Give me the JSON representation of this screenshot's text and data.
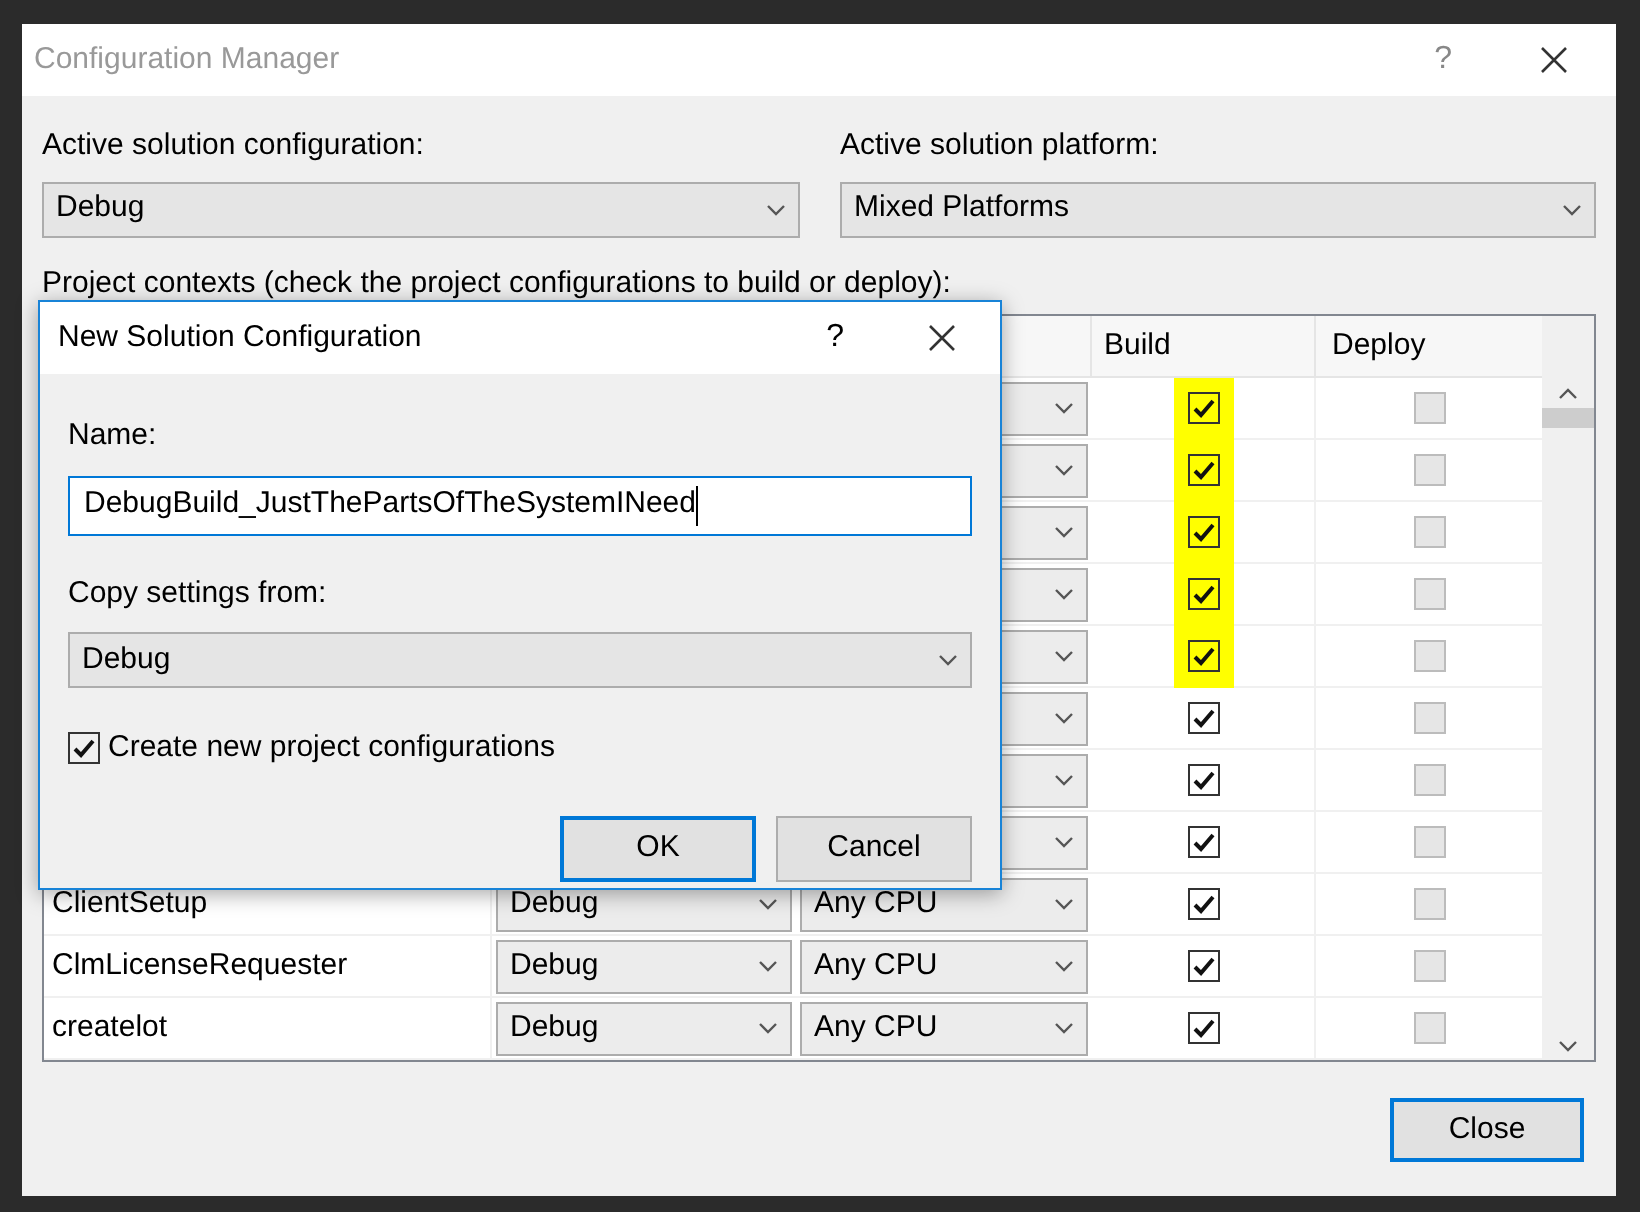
{
  "window": {
    "title": "Configuration Manager",
    "help": "?"
  },
  "active_configuration": {
    "label": "Active solution configuration:",
    "value": "Debug"
  },
  "active_platform": {
    "label": "Active solution platform:",
    "value": "Mixed Platforms"
  },
  "contexts_label": "Project contexts (check the project configurations to build or deploy):",
  "table": {
    "columns": [
      "Build",
      "Deploy"
    ],
    "rows": [
      {
        "build": true,
        "deploy": false,
        "highlighted": true
      },
      {
        "build": true,
        "deploy": false,
        "highlighted": true
      },
      {
        "build": true,
        "deploy": false,
        "highlighted": true
      },
      {
        "build": true,
        "deploy": false,
        "highlighted": true
      },
      {
        "build": true,
        "deploy": false,
        "highlighted": true
      },
      {
        "build": true,
        "deploy": false,
        "highlighted": false
      },
      {
        "build": true,
        "deploy": false,
        "highlighted": false
      },
      {
        "build": true,
        "deploy": false,
        "highlighted": false
      },
      {
        "project": "ClientSetup",
        "configuration": "Debug",
        "platform": "Any CPU",
        "build": true,
        "deploy": false,
        "highlighted": false
      },
      {
        "project": "ClmLicenseRequester",
        "configuration": "Debug",
        "platform": "Any CPU",
        "build": true,
        "deploy": false,
        "highlighted": false
      },
      {
        "project": "createlot",
        "configuration": "Debug",
        "platform": "Any CPU",
        "build": true,
        "deploy": false,
        "highlighted": false
      }
    ]
  },
  "close_button": "Close",
  "dialog": {
    "title": "New Solution Configuration",
    "help": "?",
    "name_label": "Name:",
    "name_value": "DebugBuild_JustThePartsOfTheSystemINeed",
    "copy_label": "Copy settings from:",
    "copy_value": "Debug",
    "create_label": "Create new project configurations",
    "create_checked": true,
    "ok": "OK",
    "cancel": "Cancel"
  }
}
